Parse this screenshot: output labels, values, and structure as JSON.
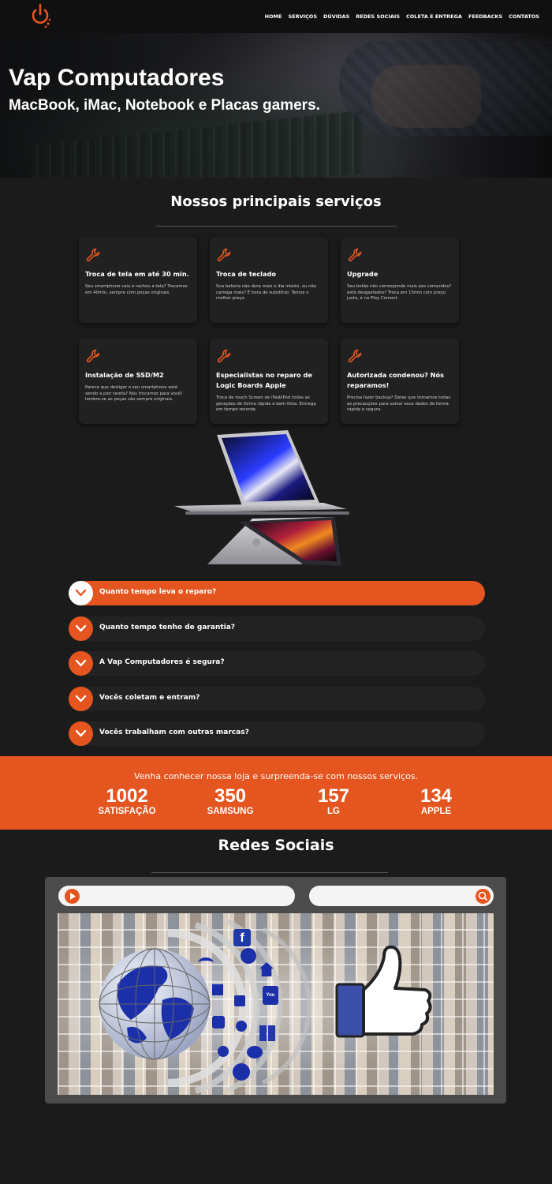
{
  "nav": {
    "logo_icon": "power-logo-icon",
    "items": [
      "HOME",
      "SERVIÇOS",
      "DÚVIDAS",
      "REDES SOCIAIS",
      "COLETA E ENTREGA",
      "FEEDBACKS",
      "CONTATOS"
    ]
  },
  "hero": {
    "title": "Vap Computadores",
    "subtitle": "MacBook, iMac, Notebook e Placas gamers."
  },
  "services": {
    "heading": "Nossos principais serviços",
    "icon": "wrench-icon",
    "cards": [
      {
        "title": "Troca de tela em até 30 min.",
        "desc": "Seu smartphone caiu e rachou a tela? Trocamos em 40min, sempre com peças originais."
      },
      {
        "title": "Troca de teclado",
        "desc": "Sua bateria não dura mais o dia inteiro, ou não carrega mais? É hora de substituir. Temos o melhor preço."
      },
      {
        "title": "Upgrade",
        "desc": "Seu botão não corresponde mais aos comandos? está desgastados? Troca em 15min com preço justo, é na Play Consert."
      },
      {
        "title": "Instalação de SSD/M2",
        "desc": "Parece que desligar o seu smartphone está sendo a pior tarefa? Nós trocamos para você! lembre-se as peças são sempre originais."
      },
      {
        "title": "Especialistas no reparo de Logic Boards Apple",
        "desc": "Troca de touch Screen de iPad/iPod todas as gerações de forma rápida e bem feita. Entrega em tempo recorde."
      },
      {
        "title": "Autorizada condenou? Nós reparamos!",
        "desc": "Precisa fazer backup? Deixe que tomamos todas as precauções para salvar seus dados de forma rápida e segura."
      }
    ]
  },
  "faq": {
    "icon": "chevron-down-icon",
    "items": [
      "Quanto tempo leva o reparo?",
      "Quanto tempo tenho de garantia?",
      "A Vap Computadores é segura?",
      "Vocês coletam e entram?",
      "Vocês trabalham com outras marcas?"
    ],
    "active_index": 0
  },
  "stats": {
    "tagline": "Venha conhecer nossa loja e surpreenda-se com nossos serviços.",
    "items": [
      {
        "number": "1002",
        "label": "SATISFAÇÃO"
      },
      {
        "number": "350",
        "label": "SAMSUNG"
      },
      {
        "number": "157",
        "label": "LG"
      },
      {
        "number": "134",
        "label": "APPLE"
      }
    ]
  },
  "social": {
    "heading": "Redes Sociais",
    "play_icon": "play-icon",
    "search_icon": "search-icon",
    "globe_icon": "globe-icon",
    "like_icon": "thumbs-up-icon",
    "social_icons": [
      "facebook-icon",
      "youtube-icon",
      "twitter-icon",
      "wifi-icon",
      "home-icon",
      "chat-icon",
      "phone-icon",
      "windows-icon"
    ]
  },
  "colors": {
    "accent": "#e4551f",
    "background": "#1b1b1b",
    "card": "#212121",
    "nav": "#101010"
  }
}
